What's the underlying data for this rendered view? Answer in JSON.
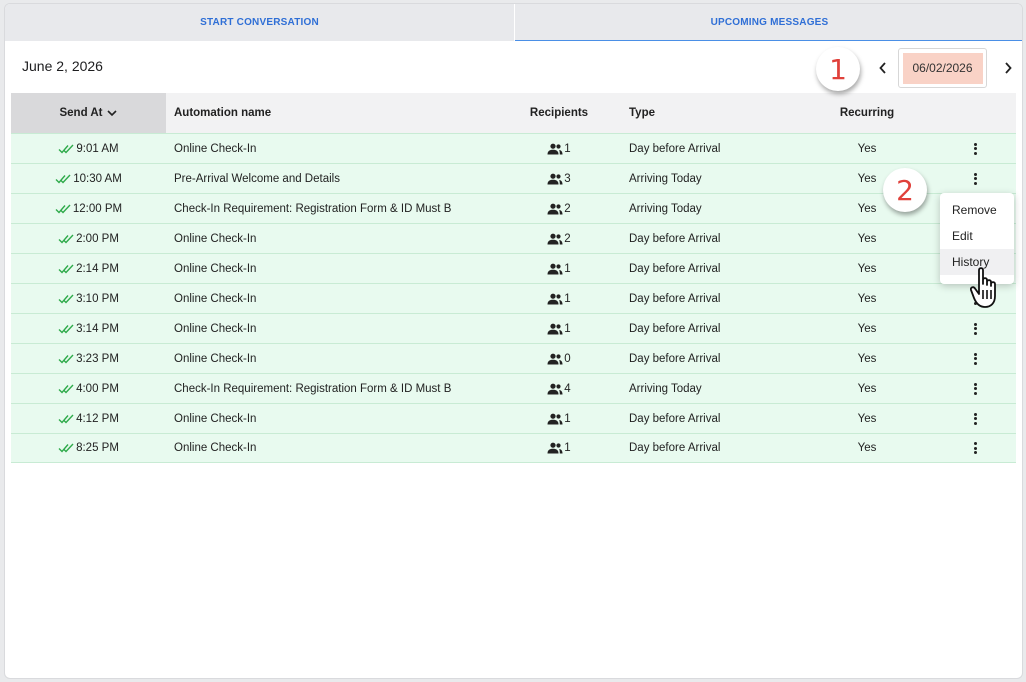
{
  "tabs": [
    {
      "label": "START CONVERSATION",
      "active": false
    },
    {
      "label": "UPCOMING MESSAGES",
      "active": true
    }
  ],
  "date_title": "June 2, 2026",
  "date_picker": {
    "value": "06/02/2026",
    "prev_icon": "chevron-left-icon",
    "next_icon": "chevron-right-icon"
  },
  "table": {
    "headers": {
      "send_at": "Send At",
      "name": "Automation name",
      "recipients": "Recipients",
      "type": "Type",
      "recurring": "Recurring"
    },
    "rows": [
      {
        "send_at": "9:01 AM",
        "name": "Online Check-In",
        "recipients": "1",
        "type": "Day before Arrival",
        "recurring": "Yes"
      },
      {
        "send_at": "10:30 AM",
        "name": "Pre-Arrival Welcome and Details",
        "recipients": "3",
        "type": "Arriving Today",
        "recurring": "Yes"
      },
      {
        "send_at": "12:00 PM",
        "name": "Check-In Requirement: Registration Form & ID Must B",
        "recipients": "2",
        "type": "Arriving Today",
        "recurring": "Yes"
      },
      {
        "send_at": "2:00 PM",
        "name": "Online Check-In",
        "recipients": "2",
        "type": "Day before Arrival",
        "recurring": "Yes"
      },
      {
        "send_at": "2:14 PM",
        "name": "Online Check-In",
        "recipients": "1",
        "type": "Day before Arrival",
        "recurring": "Yes"
      },
      {
        "send_at": "3:10 PM",
        "name": "Online Check-In",
        "recipients": "1",
        "type": "Day before Arrival",
        "recurring": "Yes"
      },
      {
        "send_at": "3:14 PM",
        "name": "Online Check-In",
        "recipients": "1",
        "type": "Day before Arrival",
        "recurring": "Yes"
      },
      {
        "send_at": "3:23 PM",
        "name": "Online Check-In",
        "recipients": "0",
        "type": "Day before Arrival",
        "recurring": "Yes"
      },
      {
        "send_at": "4:00 PM",
        "name": "Check-In Requirement: Registration Form & ID Must B",
        "recipients": "4",
        "type": "Arriving Today",
        "recurring": "Yes"
      },
      {
        "send_at": "4:12 PM",
        "name": "Online Check-In",
        "recipients": "1",
        "type": "Day before Arrival",
        "recurring": "Yes"
      },
      {
        "send_at": "8:25 PM",
        "name": "Online Check-In",
        "recipients": "1",
        "type": "Day before Arrival",
        "recurring": "Yes"
      }
    ]
  },
  "context_menu": {
    "items": [
      "Remove",
      "Edit",
      "History"
    ],
    "hovered": "History"
  },
  "callouts": {
    "one": "1",
    "two": "2"
  },
  "colors": {
    "row_bg": "#e8faef",
    "accent": "#2f6fd6",
    "date_input_bg": "#f9d2c6",
    "callout": "#e0413b",
    "check": "#2eaa4a"
  }
}
